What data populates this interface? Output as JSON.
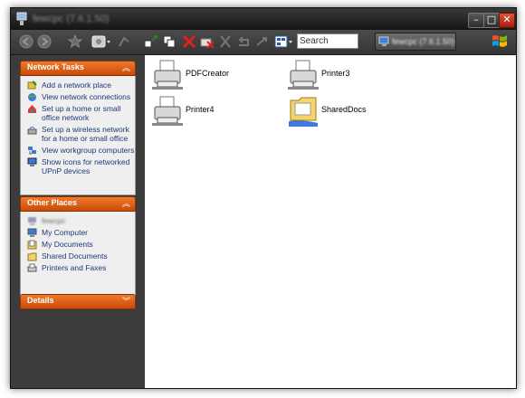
{
  "window": {
    "title": "fewcpc (7.6.1.50)"
  },
  "toolbar": {
    "search_placeholder": "Search",
    "address_text": "fewcpc (7.6.1.50)"
  },
  "panels": {
    "network_tasks": {
      "title": "Network Tasks",
      "items": [
        {
          "label": "Add a network place",
          "icon": "add-network-place-icon"
        },
        {
          "label": "View network connections",
          "icon": "network-connections-icon"
        },
        {
          "label": "Set up a home or small office network",
          "icon": "home-network-icon"
        },
        {
          "label": "Set up a wireless network for a home or small office",
          "icon": "wireless-network-icon"
        },
        {
          "label": "View workgroup computers",
          "icon": "workgroup-icon"
        },
        {
          "label": "Show icons for networked UPnP devices",
          "icon": "upnp-icon"
        }
      ]
    },
    "other_places": {
      "title": "Other Places",
      "items": [
        {
          "label": "fewcpc",
          "icon": "network-icon",
          "blurred": true
        },
        {
          "label": "My Computer",
          "icon": "my-computer-icon"
        },
        {
          "label": "My Documents",
          "icon": "my-documents-icon"
        },
        {
          "label": "Shared Documents",
          "icon": "folder-icon"
        },
        {
          "label": "Printers and Faxes",
          "icon": "printer-icon"
        }
      ]
    },
    "details": {
      "title": "Details"
    }
  },
  "items": [
    {
      "label": "PDFCreator",
      "type": "printer"
    },
    {
      "label": "Printer3",
      "type": "printer"
    },
    {
      "label": "Printer4",
      "type": "printer"
    },
    {
      "label": "SharedDocs",
      "type": "shared-folder"
    }
  ],
  "colors": {
    "accent": "#e0601a",
    "pane": "#3c3c3c",
    "link": "#1b3a7a"
  }
}
